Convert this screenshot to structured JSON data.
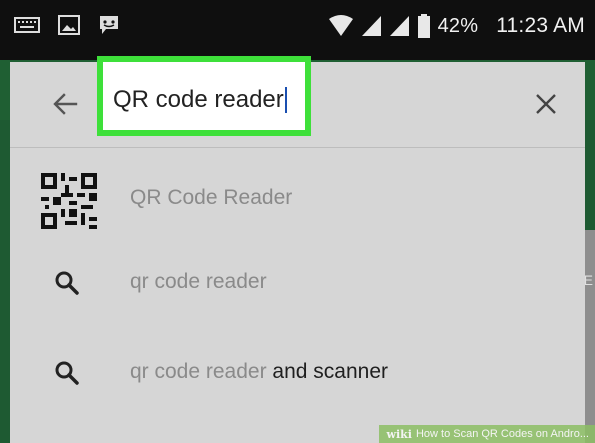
{
  "status_bar": {
    "battery_percent": "42%",
    "time": "11:23 AM",
    "icons": [
      "keyboard-icon",
      "image-icon",
      "chat-icon",
      "wifi-icon",
      "signal-icon",
      "signal-icon",
      "battery-icon"
    ]
  },
  "search": {
    "query": "QR code reader",
    "highlight_color": "#3ee03a"
  },
  "suggestions": [
    {
      "icon": "qr-code-icon",
      "text": "QR Code Reader",
      "suffix": ""
    },
    {
      "icon": "search-icon",
      "text": "qr code reader",
      "suffix": ""
    },
    {
      "icon": "search-icon",
      "text": "qr code reader",
      "suffix": " and scanner"
    }
  ],
  "background_hint": "E",
  "watermark": {
    "logo": "wiki",
    "text": "How to Scan QR Codes on Andro..."
  }
}
